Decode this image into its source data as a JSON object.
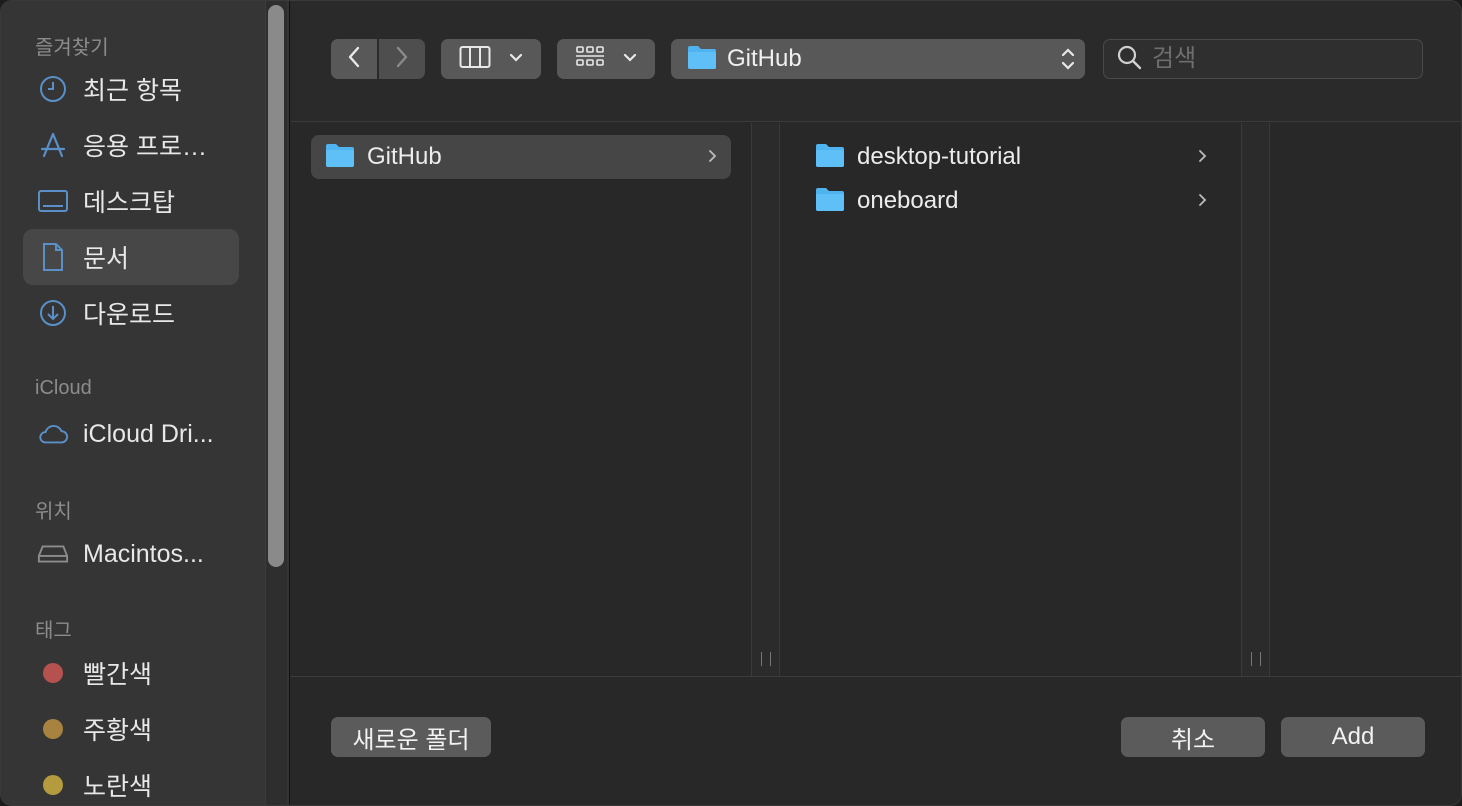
{
  "sidebar": {
    "favorites_heading": "즐겨찾기",
    "favorites": [
      {
        "label": "최근 항목",
        "icon": "clock-icon",
        "selected": false
      },
      {
        "label": "응용 프로…",
        "icon": "applications-icon",
        "selected": false
      },
      {
        "label": "데스크탑",
        "icon": "desktop-icon",
        "selected": false
      },
      {
        "label": "문서",
        "icon": "document-icon",
        "selected": true
      },
      {
        "label": "다운로드",
        "icon": "download-icon",
        "selected": false
      }
    ],
    "icloud_heading": "iCloud",
    "icloud": [
      {
        "label": "iCloud Dri...",
        "icon": "cloud-icon"
      }
    ],
    "locations_heading": "위치",
    "locations": [
      {
        "label": "Macintos...",
        "icon": "hard-drive-icon"
      }
    ],
    "tags_heading": "태그",
    "tags": [
      {
        "label": "빨간색",
        "color": "#b5524f"
      },
      {
        "label": "주황색",
        "color": "#a8823f"
      },
      {
        "label": "노란색",
        "color": "#b39b3e"
      }
    ]
  },
  "toolbar": {
    "back_icon": "chevron-left-icon",
    "forward_icon": "chevron-right-icon",
    "view_mode_icon": "column-view-icon",
    "group_icon": "grid-icon",
    "current_folder": "GitHub",
    "search_placeholder": "검색"
  },
  "browser": {
    "column1": [
      {
        "label": "GitHub",
        "selected": true,
        "has_children": true
      }
    ],
    "column2": [
      {
        "label": "desktop-tutorial",
        "selected": false,
        "has_children": true
      },
      {
        "label": "oneboard",
        "selected": false,
        "has_children": true
      }
    ]
  },
  "footer": {
    "new_folder_label": "새로운 폴더",
    "cancel_label": "취소",
    "add_label": "Add"
  },
  "colors": {
    "accent_folder": "#4fb3f0",
    "sidebar_icon": "#5a8fc8"
  }
}
